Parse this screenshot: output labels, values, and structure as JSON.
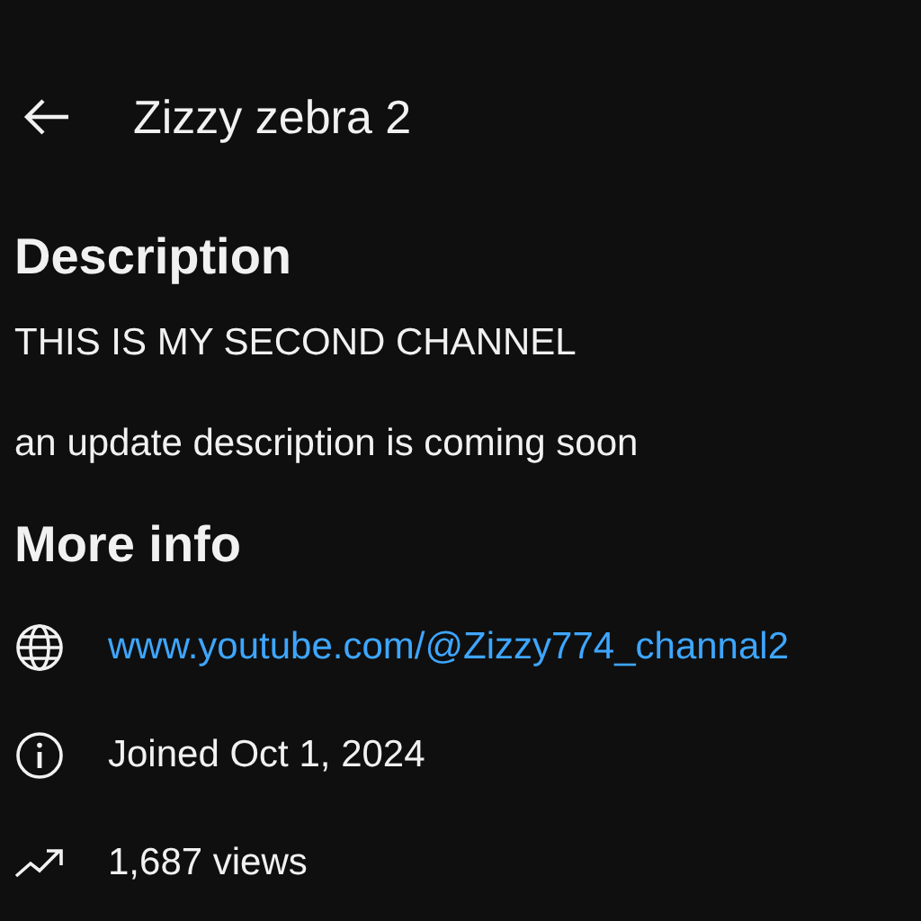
{
  "header": {
    "title": "Zizzy zebra 2"
  },
  "description": {
    "heading": "Description",
    "paragraphs": [
      "THIS IS MY SECOND CHANNEL",
      "an update description is coming soon"
    ]
  },
  "more_info": {
    "heading": "More info",
    "items": [
      {
        "kind": "link",
        "text": "www.youtube.com/@Zizzy774_channal2"
      },
      {
        "kind": "joined",
        "text": "Joined Oct 1, 2024"
      },
      {
        "kind": "views",
        "text": "1,687 views"
      }
    ]
  }
}
